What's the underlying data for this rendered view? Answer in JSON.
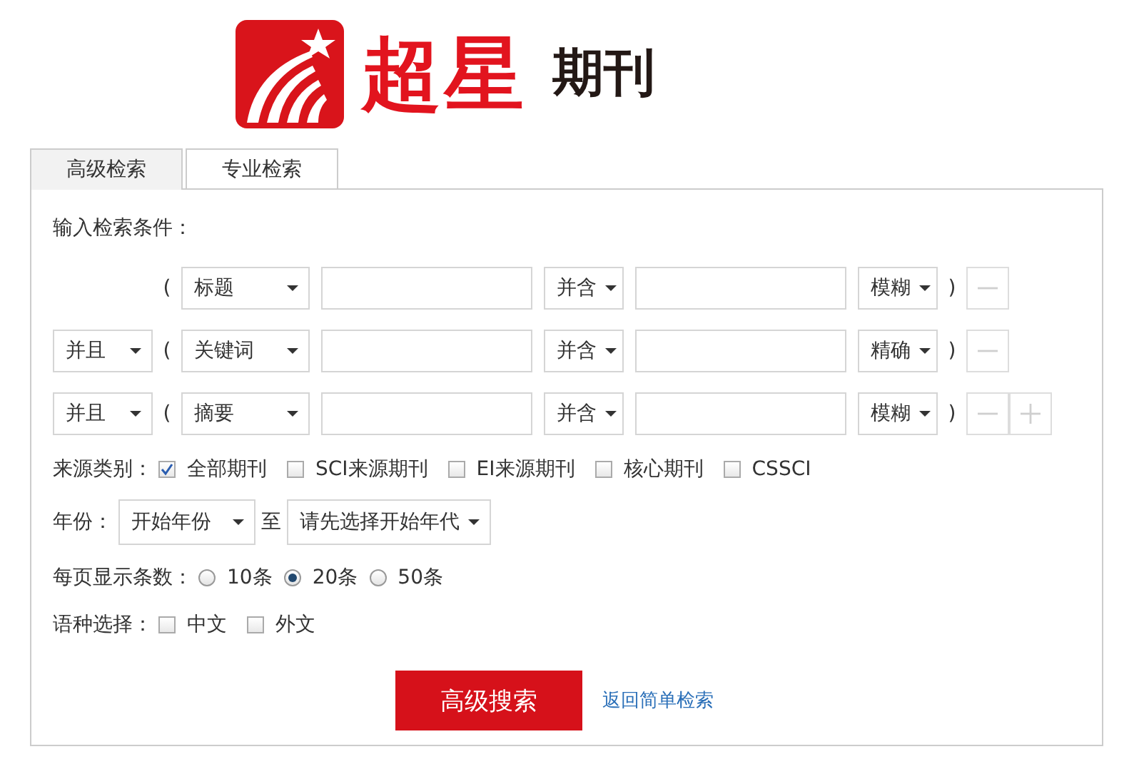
{
  "logo": {
    "brand": "超星",
    "product": "期刊"
  },
  "tabs": [
    {
      "label": "高级检索",
      "selected": true
    },
    {
      "label": "专业检索",
      "selected": false
    }
  ],
  "prompt": "输入检索条件：",
  "rows": [
    {
      "open": "(",
      "field": "标题",
      "operator": "并含",
      "match": "模糊",
      "close": ")",
      "buttons": [
        {
          "kind": "remove"
        }
      ]
    },
    {
      "conjunction": "并且",
      "open": "(",
      "field": "关键词",
      "operator": "并含",
      "match": "精确",
      "close": ")",
      "buttons": [
        {
          "kind": "remove"
        }
      ]
    },
    {
      "conjunction": "并且",
      "open": "(",
      "field": "摘要",
      "operator": "并含",
      "match": "模糊",
      "close": ")",
      "buttons": [
        {
          "kind": "remove"
        },
        {
          "kind": "add"
        }
      ]
    }
  ],
  "source": {
    "label": "来源类别：",
    "options": [
      {
        "label": "全部期刊",
        "checked": true
      },
      {
        "label": "SCI来源期刊",
        "checked": false
      },
      {
        "label": "EI来源期刊",
        "checked": false
      },
      {
        "label": "核心期刊",
        "checked": false
      },
      {
        "label": "CSSCI",
        "checked": false
      }
    ]
  },
  "year": {
    "label": "年份：",
    "from": "开始年份",
    "separator": "至",
    "to": "请先选择开始年代"
  },
  "per_page": {
    "label": "每页显示条数：",
    "options": [
      {
        "label": "10条",
        "selected": false
      },
      {
        "label": "20条",
        "selected": true
      },
      {
        "label": "50条",
        "selected": false
      }
    ]
  },
  "language": {
    "label": "语种选择：",
    "options": [
      {
        "label": "中文",
        "checked": false
      },
      {
        "label": "外文",
        "checked": false
      }
    ]
  },
  "submit": "高级搜索",
  "back_link": "返回简单检索"
}
